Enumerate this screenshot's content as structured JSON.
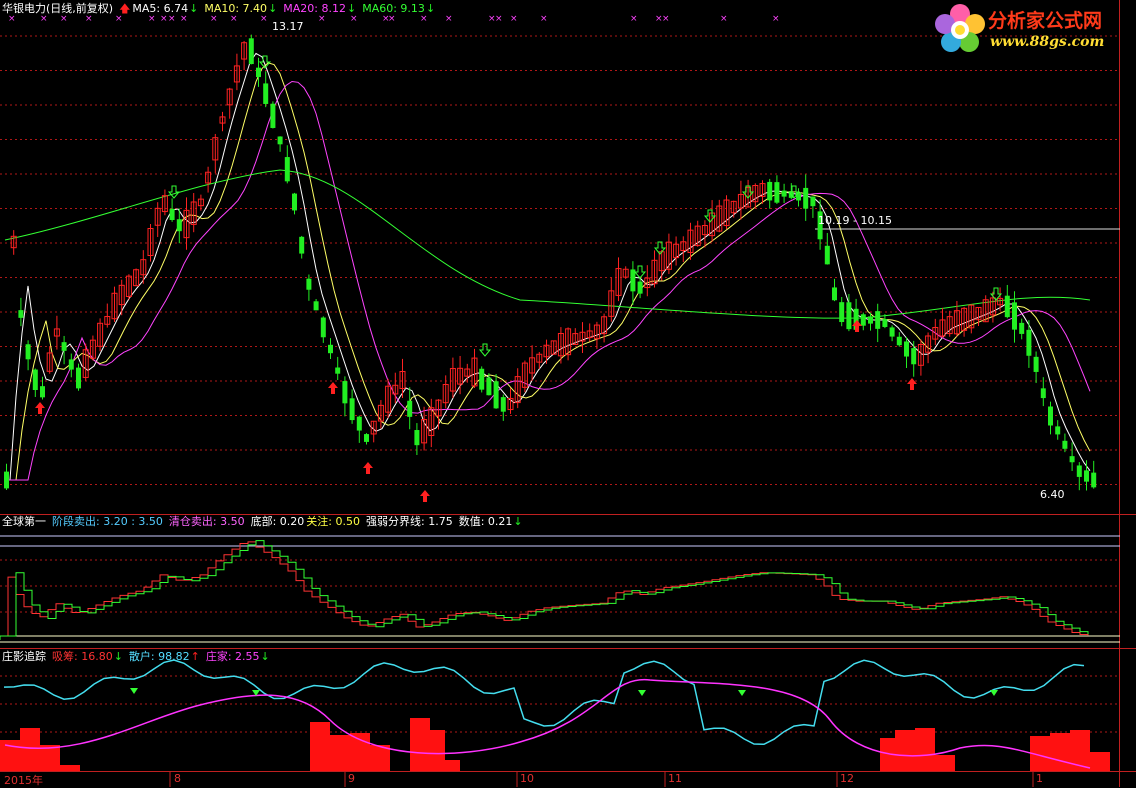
{
  "main": {
    "stock_title": "华银电力(日线,前复权)",
    "ma": [
      {
        "label": "MA5: 6.74",
        "color": "#ffffff",
        "dir": "down"
      },
      {
        "label": "MA10: 7.40",
        "color": "#ffff66",
        "dir": "down"
      },
      {
        "label": "MA20: 8.12",
        "color": "#ff44ff",
        "dir": "down"
      },
      {
        "label": "MA60: 9.13",
        "color": "#33ff33",
        "dir": "down"
      }
    ],
    "high_label": "13.17",
    "low_label": "6.40",
    "range_label": "10.19 - 10.15"
  },
  "panel2": {
    "title": "全球第一",
    "items": [
      {
        "label": "阶段卖出: 3.20 : 3.50",
        "color": "#55ccff"
      },
      {
        "label": "清仓卖出: 3.50",
        "color": "#ff66ff"
      },
      {
        "label": "底部: 0.20",
        "color": "#ffffff"
      },
      {
        "label": "关注: 0.50",
        "color": "#ffff44"
      },
      {
        "label": "强弱分界线: 1.75",
        "color": "#ffffff"
      },
      {
        "label": "数值: 0.21",
        "color": "#ffffff"
      }
    ]
  },
  "panel3": {
    "title": "庄影追踪",
    "items": [
      {
        "label": "吸筹: 16.80",
        "color": "#ff3333",
        "dir": "down"
      },
      {
        "label": "散户: 98.82",
        "color": "#55ddff",
        "dir": "up"
      },
      {
        "label": "庄家: 2.55",
        "color": "#ff44ff",
        "dir": "down"
      }
    ]
  },
  "xaxis": {
    "labels": [
      "2015年",
      "8",
      "9",
      "10",
      "11",
      "12",
      "1"
    ]
  },
  "logo": {
    "brand": "分析家公式网",
    "url": "www.88gs.com"
  },
  "colors": {
    "up": "#ff2222",
    "down": "#22ee22",
    "grid": "#b01818",
    "ma5": "#ffffff",
    "ma10": "#ffff66",
    "ma20": "#ff44ff",
    "ma60": "#33ff33",
    "sanhu": "#44ddee",
    "zhuangjia": "#ff33ff",
    "xichou": "#ff1111"
  }
}
